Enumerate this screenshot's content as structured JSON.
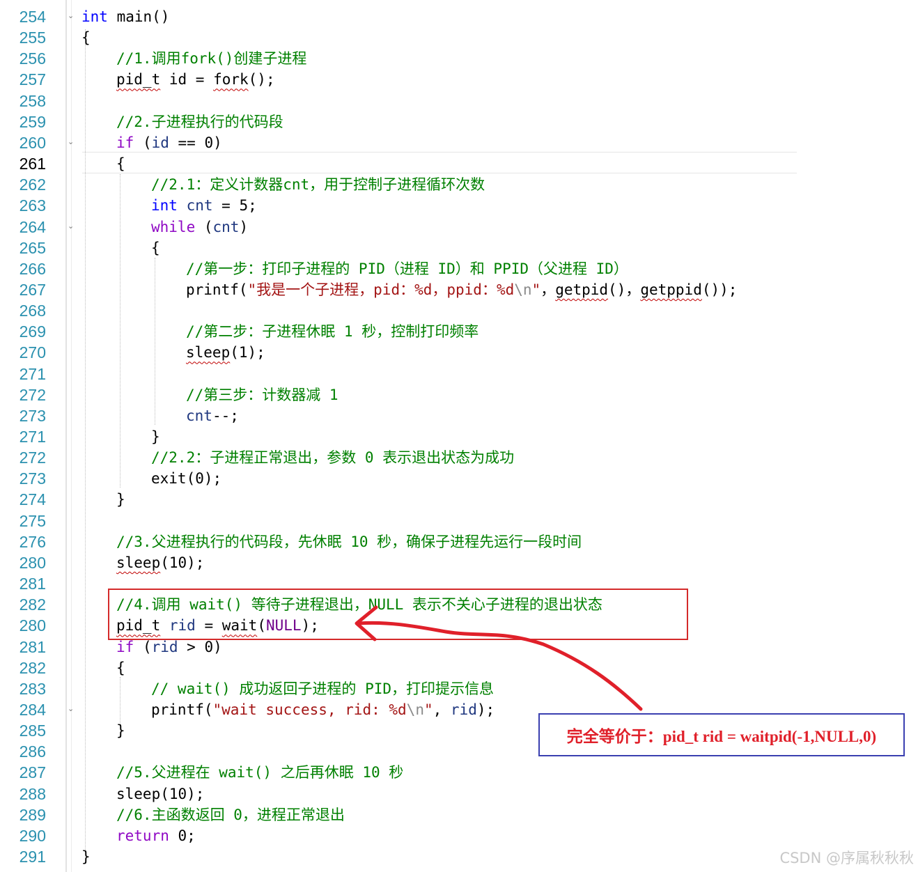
{
  "lines": [
    {
      "ln": "254",
      "fold": "⌄",
      "indent": 0,
      "tokens": [
        {
          "t": "int",
          "c": "kw"
        },
        {
          "t": " main()",
          "c": "fn"
        }
      ]
    },
    {
      "ln": "255",
      "indent": 0,
      "tokens": [
        {
          "t": "{",
          "c": "fn"
        }
      ]
    },
    {
      "ln": "256",
      "indent": 1,
      "tokens": [
        {
          "t": "//1.调用fork()创建子进程",
          "c": "cm"
        }
      ]
    },
    {
      "ln": "257",
      "indent": 1,
      "tokens": [
        {
          "t": "pid_t",
          "c": "fn",
          "sq": true
        },
        {
          "t": " id = ",
          "c": "fn"
        },
        {
          "t": "fork",
          "c": "fn",
          "sq": true
        },
        {
          "t": "();",
          "c": "fn"
        }
      ]
    },
    {
      "ln": "258",
      "indent": 1,
      "tokens": []
    },
    {
      "ln": "259",
      "indent": 1,
      "tokens": [
        {
          "t": "//2.子进程执行的代码段",
          "c": "cm"
        }
      ]
    },
    {
      "ln": "260",
      "fold": "⌄",
      "indent": 1,
      "tokens": [
        {
          "t": "if",
          "c": "kw2"
        },
        {
          "t": " (",
          "c": "fn"
        },
        {
          "t": "id",
          "c": "var"
        },
        {
          "t": " == 0)",
          "c": "fn"
        }
      ]
    },
    {
      "ln": "261",
      "current": true,
      "indent": 1,
      "tokens": [
        {
          "t": "{",
          "c": "fn"
        }
      ]
    },
    {
      "ln": "262",
      "indent": 2,
      "tokens": [
        {
          "t": "//2.1：定义计数器cnt，用于控制子进程循环次数",
          "c": "cm"
        }
      ]
    },
    {
      "ln": "263",
      "indent": 2,
      "tokens": [
        {
          "t": "int",
          "c": "kw"
        },
        {
          "t": " ",
          "c": "fn"
        },
        {
          "t": "cnt",
          "c": "var"
        },
        {
          "t": " = 5;",
          "c": "fn"
        }
      ]
    },
    {
      "ln": "264",
      "fold": "⌄",
      "indent": 2,
      "tokens": [
        {
          "t": "while",
          "c": "kw2"
        },
        {
          "t": " (",
          "c": "fn"
        },
        {
          "t": "cnt",
          "c": "var"
        },
        {
          "t": ")",
          "c": "fn"
        }
      ]
    },
    {
      "ln": "265",
      "indent": 2,
      "tokens": [
        {
          "t": "{",
          "c": "fn"
        }
      ]
    },
    {
      "ln": "266",
      "indent": 3,
      "tokens": [
        {
          "t": "//第一步：打印子进程的 PID（进程 ID）和 PPID（父进程 ID）",
          "c": "cm"
        }
      ]
    },
    {
      "ln": "267",
      "indent": 3,
      "tokens": [
        {
          "t": "printf(",
          "c": "fn"
        },
        {
          "t": "\"我是一个子进程，pid：%d，ppid：%d",
          "c": "str"
        },
        {
          "t": "\\n",
          "c": "esc"
        },
        {
          "t": "\"",
          "c": "str"
        },
        {
          "t": "，",
          "c": "fn"
        },
        {
          "t": "getpid",
          "c": "fn",
          "sq": true
        },
        {
          "t": "()，",
          "c": "fn"
        },
        {
          "t": "getppid",
          "c": "fn",
          "sq": true
        },
        {
          "t": "());",
          "c": "fn"
        }
      ]
    },
    {
      "ln": "268",
      "indent": 3,
      "tokens": []
    },
    {
      "ln": "269",
      "indent": 3,
      "tokens": [
        {
          "t": "//第二步：子进程休眠 1 秒，控制打印频率",
          "c": "cm"
        }
      ]
    },
    {
      "ln": "270",
      "indent": 3,
      "tokens": [
        {
          "t": "sleep",
          "c": "fn",
          "sq": true
        },
        {
          "t": "(1);",
          "c": "fn"
        }
      ]
    },
    {
      "ln": "271",
      "indent": 3,
      "tokens": []
    },
    {
      "ln": "272",
      "indent": 3,
      "tokens": [
        {
          "t": "//第三步：计数器减 1",
          "c": "cm"
        }
      ]
    },
    {
      "ln": "273",
      "indent": 3,
      "tokens": [
        {
          "t": "cnt",
          "c": "var"
        },
        {
          "t": "--;",
          "c": "fn"
        }
      ]
    },
    {
      "ln": "271",
      "indent": 2,
      "tokens": [
        {
          "t": "}",
          "c": "fn"
        }
      ]
    },
    {
      "ln": "272",
      "indent": 2,
      "tokens": [
        {
          "t": "//2.2：子进程正常退出，参数 0 表示退出状态为成功",
          "c": "cm"
        }
      ]
    },
    {
      "ln": "273",
      "indent": 2,
      "tokens": [
        {
          "t": "exit(0);",
          "c": "fn"
        }
      ]
    },
    {
      "ln": "274",
      "indent": 1,
      "tokens": [
        {
          "t": "}",
          "c": "fn"
        }
      ]
    },
    {
      "ln": "275",
      "indent": 1,
      "tokens": []
    },
    {
      "ln": "276",
      "indent": 1,
      "tokens": [
        {
          "t": "//3.父进程执行的代码段，先休眠 10 秒，确保子进程先运行一段时间",
          "c": "cm"
        }
      ]
    },
    {
      "ln": "280",
      "indent": 1,
      "tokens": [
        {
          "t": "sleep",
          "c": "fn",
          "sq": true
        },
        {
          "t": "(10);",
          "c": "fn"
        }
      ]
    },
    {
      "ln": "281",
      "indent": 1,
      "tokens": []
    },
    {
      "ln": "282",
      "indent": 1,
      "tokens": [
        {
          "t": "//4.调用 wait() 等待子进程退出，NULL 表示不关心子进程的退出状态",
          "c": "cm"
        }
      ]
    },
    {
      "ln": "280",
      "indent": 1,
      "tokens": [
        {
          "t": "pid_t",
          "c": "fn",
          "sq": true
        },
        {
          "t": " ",
          "c": "fn"
        },
        {
          "t": "rid",
          "c": "var"
        },
        {
          "t": " = ",
          "c": "fn"
        },
        {
          "t": "wait",
          "c": "fn",
          "sq": true
        },
        {
          "t": "(",
          "c": "fn"
        },
        {
          "t": "NULL",
          "c": "mac"
        },
        {
          "t": ");",
          "c": "fn"
        }
      ]
    },
    {
      "ln": "281",
      "indent": 1,
      "tokens": [
        {
          "t": "if",
          "c": "kw2"
        },
        {
          "t": " (",
          "c": "fn"
        },
        {
          "t": "rid",
          "c": "var"
        },
        {
          "t": " > 0)",
          "c": "fn"
        }
      ]
    },
    {
      "ln": "282",
      "indent": 1,
      "tokens": [
        {
          "t": "{",
          "c": "fn"
        }
      ]
    },
    {
      "ln": "283",
      "indent": 2,
      "tokens": [
        {
          "t": "// wait() 成功返回子进程的 PID，打印提示信息",
          "c": "cm"
        }
      ]
    },
    {
      "ln": "284",
      "fold": "⌄",
      "indent": 2,
      "tokens": [
        {
          "t": "printf(",
          "c": "fn"
        },
        {
          "t": "\"wait success, rid: %d",
          "c": "str"
        },
        {
          "t": "\\n",
          "c": "esc"
        },
        {
          "t": "\"",
          "c": "str"
        },
        {
          "t": ", ",
          "c": "fn"
        },
        {
          "t": "rid",
          "c": "var"
        },
        {
          "t": ");",
          "c": "fn"
        }
      ]
    },
    {
      "ln": "285",
      "indent": 1,
      "tokens": [
        {
          "t": "}",
          "c": "fn"
        }
      ]
    },
    {
      "ln": "286",
      "indent": 1,
      "tokens": []
    },
    {
      "ln": "287",
      "indent": 1,
      "tokens": [
        {
          "t": "//5.父进程在 wait() 之后再休眠 10 秒",
          "c": "cm"
        }
      ]
    },
    {
      "ln": "288",
      "indent": 1,
      "tokens": [
        {
          "t": "sleep",
          "c": "fn"
        },
        {
          "t": "(10);",
          "c": "fn"
        }
      ]
    },
    {
      "ln": "289",
      "indent": 1,
      "tokens": [
        {
          "t": "//6.主函数返回 0，进程正常退出",
          "c": "cm"
        }
      ]
    },
    {
      "ln": "290",
      "indent": 1,
      "tokens": [
        {
          "t": "return",
          "c": "kw2"
        },
        {
          "t": " 0;",
          "c": "fn"
        }
      ]
    },
    {
      "ln": "291",
      "indent": 0,
      "tokens": [
        {
          "t": "}",
          "c": "fn"
        }
      ]
    }
  ],
  "annotation": {
    "note": "完全等价于：pid_t rid = waitpid(-1,NULL,0)",
    "box_color": "#d42a2a",
    "note_box_color": "#3a3fb0",
    "arrow_color": "#e0202a"
  },
  "watermark": "CSDN @序属秋秋秋",
  "colors": {
    "line_number": "#2b91af",
    "keyword_type": "#0000ff",
    "keyword_control": "#8f08c4",
    "comment": "#008000",
    "string": "#a31515",
    "macro": "#6f008a"
  }
}
